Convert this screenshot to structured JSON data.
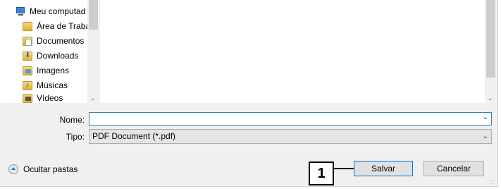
{
  "navigation": {
    "items": [
      {
        "label": "Meu computad",
        "icon": "computer-icon"
      },
      {
        "label": "Área de Traba",
        "icon": "folder-icon"
      },
      {
        "label": "Documentos",
        "icon": "documents-folder-icon"
      },
      {
        "label": "Downloads",
        "icon": "downloads-folder-icon"
      },
      {
        "label": "Imagens",
        "icon": "pictures-folder-icon"
      },
      {
        "label": "Músicas",
        "icon": "music-folder-icon"
      },
      {
        "label": "Vídeos",
        "icon": "videos-folder-icon"
      }
    ]
  },
  "form": {
    "name_label": "Nome:",
    "name_value": "",
    "type_label": "Tipo:",
    "type_value": "PDF Document (*.pdf)"
  },
  "footer": {
    "hide_folders_label": "Ocultar pastas",
    "save_label": "Salvar",
    "cancel_label": "Cancelar"
  },
  "callout": {
    "number": "1"
  },
  "colors": {
    "dialog_bg": "#f0f0f0",
    "focus_border": "#3c7fb1",
    "primary_border": "#0078d7"
  }
}
